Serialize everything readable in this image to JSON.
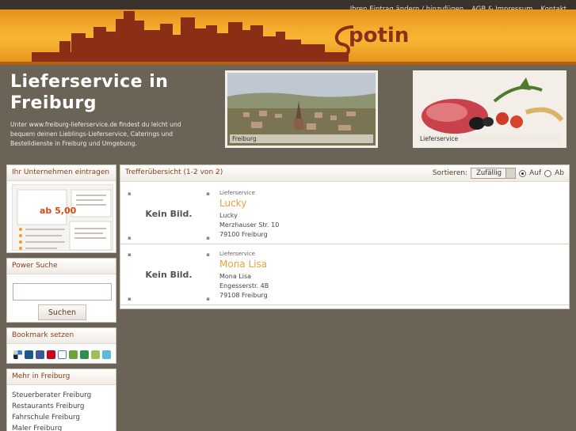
{
  "topnav": {
    "links": [
      "Ihren Eintrag ändern / hinzufügen",
      "AGB & Impressum",
      "Kontakt"
    ]
  },
  "logo": {
    "text": "potin"
  },
  "intro": {
    "title": "Lieferservice in Freiburg",
    "text": "Unter www.freiburg-lieferservice.de findest du leicht und bequem deinen Lieblings-Lieferservice, Caterings und Bestelldienste in Freiburg und Umgebung."
  },
  "photos": [
    {
      "caption": "Freiburg"
    },
    {
      "caption": "Lieferservice"
    }
  ],
  "sidebar": {
    "register": {
      "title": "Ihr Unternehmen eintragen",
      "ad_price": "ab 5,00"
    },
    "search": {
      "title": "Power Suche",
      "button": "Suchen",
      "value": ""
    },
    "bookmark": {
      "title": "Bookmark setzen"
    },
    "more": {
      "title": "Mehr in Freiburg",
      "items": [
        "Steuerberater Freiburg",
        "Restaurants Freiburg",
        "Fahrschule Freiburg",
        "Maler Freiburg"
      ]
    }
  },
  "results": {
    "title": "Trefferübersicht (1-2 von 2)",
    "sort_label": "Sortieren:",
    "sort_value": "Zufällig",
    "asc_label": "Auf",
    "desc_label": "Ab",
    "no_image": "Kein Bild.",
    "entries": [
      {
        "category": "Lieferservice",
        "name": "Lucky",
        "line1": "Lucky",
        "line2": "Merzhauser Str. 10",
        "line3": "79100 Freiburg"
      },
      {
        "category": "Lieferservice",
        "name": "Mona Lisa",
        "line1": "Mona Lisa",
        "line2": "Engesserstr. 4B",
        "line3": "79108 Freiburg"
      }
    ]
  },
  "colors": {
    "accent": "#e8a13a",
    "header_text": "#8b3b12",
    "banner": "#f4ad2e",
    "page_bg": "#6a6356"
  },
  "bookmark_icons": [
    "delicious-icon",
    "digg-icon",
    "facebook-icon",
    "yahoo-icon",
    "google-icon",
    "mister-wong-icon",
    "webnews-icon",
    "linkarena-icon",
    "twitter-icon"
  ]
}
